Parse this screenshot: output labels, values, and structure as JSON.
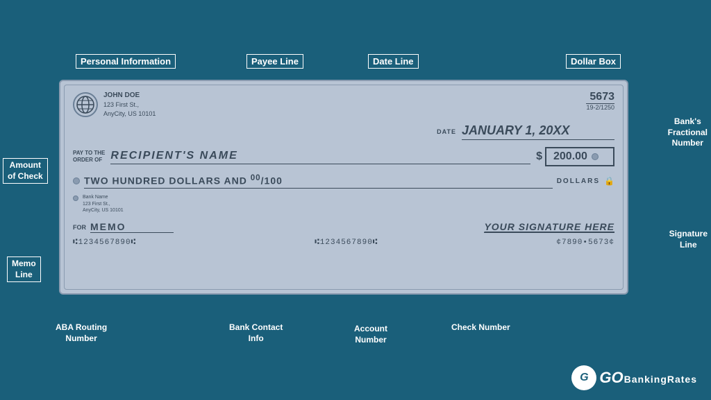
{
  "background_color": "#1a5f7a",
  "check": {
    "personal": {
      "name": "JOHN DOE",
      "address_line1": "123 First St.,",
      "address_line2": "AnyCity, US 10101"
    },
    "check_number": "5673",
    "fractional": "19-2/1250",
    "date_label": "DATE",
    "date_value": "JANUARY 1, 20XX",
    "pay_label_line1": "PAY TO THE",
    "pay_label_line2": "ORDER OF",
    "payee": "RECIPIENT'S NAME",
    "dollar_sign": "$",
    "amount_box": "200.00",
    "written_amount": "TWO HUNDRED DOLLARS AND ⁰⁰/100",
    "dollars_label": "DOLLARS",
    "bank_name": "Bank Name",
    "bank_address1": "123 First St.,",
    "bank_address2": "AnyCity, US 10101",
    "memo_label": "FOR",
    "memo_text": "MEMO",
    "signature_text": "YOUR SIGNATURE HERE",
    "micr_routing": "⫤·1234567890·⫤",
    "micr_account": "⫤·1234567890·⫤",
    "micr_check": "¤7890·5673¤"
  },
  "labels": {
    "personal_information": "Personal Information",
    "payee_line": "Payee Line",
    "date_line": "Date Line",
    "dollar_box": "Dollar Box",
    "banks_fractional": "Bank's\nFractional\nNumber",
    "amount_of_check": "Amount\nof Check",
    "memo_line": "Memo\nLine",
    "signature_line": "Signature\nLine",
    "aba_routing": "ABA Routing\nNumber",
    "bank_contact": "Bank Contact\nInfo",
    "account_number": "Account\nNumber",
    "check_number": "Check Number"
  },
  "logo": {
    "go": "GO",
    "banking": "BankingRates"
  }
}
